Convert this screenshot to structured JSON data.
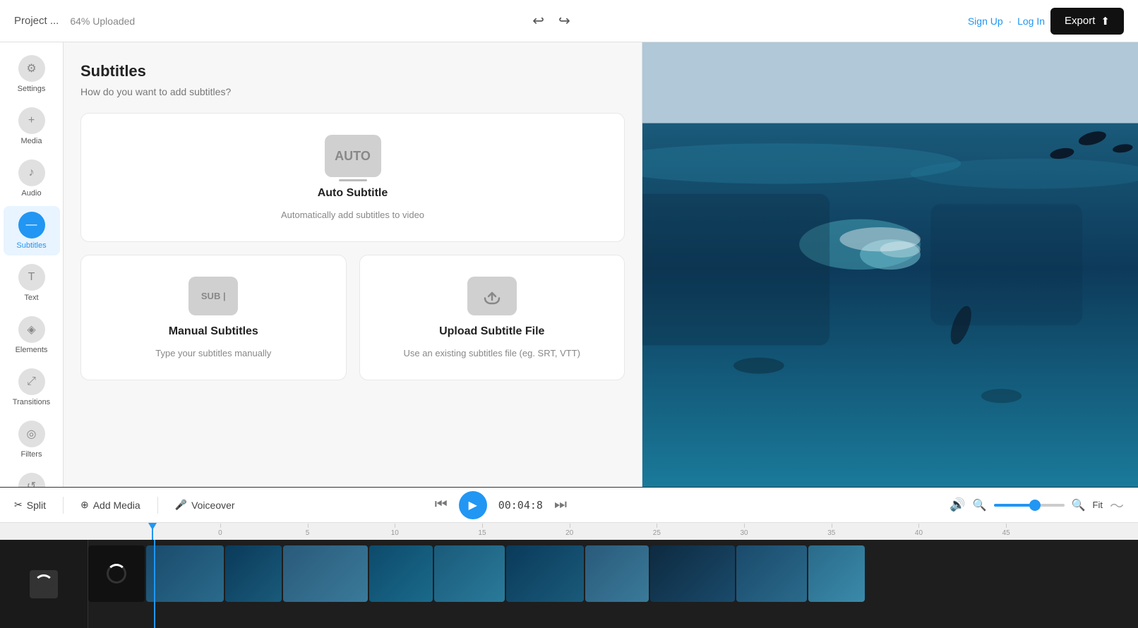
{
  "topbar": {
    "project_name": "Project ...",
    "upload_status": "64% Uploaded",
    "undo_icon": "↩",
    "redo_icon": "↪",
    "sign_up": "Sign Up",
    "separator": "·",
    "log_in": "Log In",
    "export_label": "Export",
    "export_icon": "⬆"
  },
  "sidebar": {
    "items": [
      {
        "id": "settings",
        "label": "Settings",
        "icon": "⚙"
      },
      {
        "id": "media",
        "label": "Media",
        "icon": "+"
      },
      {
        "id": "audio",
        "label": "Audio",
        "icon": "♪"
      },
      {
        "id": "subtitles",
        "label": "Subtitles",
        "icon": "—",
        "active": true
      },
      {
        "id": "text",
        "label": "Text",
        "icon": "T"
      },
      {
        "id": "elements",
        "label": "Elements",
        "icon": "◈"
      },
      {
        "id": "transitions",
        "label": "Transitions",
        "icon": "⤢"
      },
      {
        "id": "filters",
        "label": "Filters",
        "icon": "◎"
      },
      {
        "id": "unknown1",
        "label": "",
        "icon": "⤿"
      },
      {
        "id": "help",
        "label": "",
        "icon": "?"
      }
    ]
  },
  "panel": {
    "title": "Subtitles",
    "subtitle": "How do you want to add subtitles?",
    "auto_card": {
      "icon_text": "AUTO",
      "title": "Auto Subtitle",
      "description": "Automatically add subtitles to video"
    },
    "manual_card": {
      "icon_text": "SUB |",
      "title": "Manual Subtitles",
      "description": "Type your subtitles manually"
    },
    "upload_card": {
      "icon": "☁",
      "title": "Upload Subtitle File",
      "description": "Use an existing subtitles file (eg. SRT, VTT)"
    }
  },
  "toolbar": {
    "split_label": "Split",
    "add_media_label": "Add Media",
    "voiceover_label": "Voiceover",
    "time_display": "00:04:8",
    "fit_label": "Fit",
    "zoom_value": 60
  },
  "timeline": {
    "ruler_marks": [
      "0",
      "5",
      "10",
      "15",
      "20",
      "25",
      "30",
      "35",
      "40",
      "45"
    ]
  }
}
